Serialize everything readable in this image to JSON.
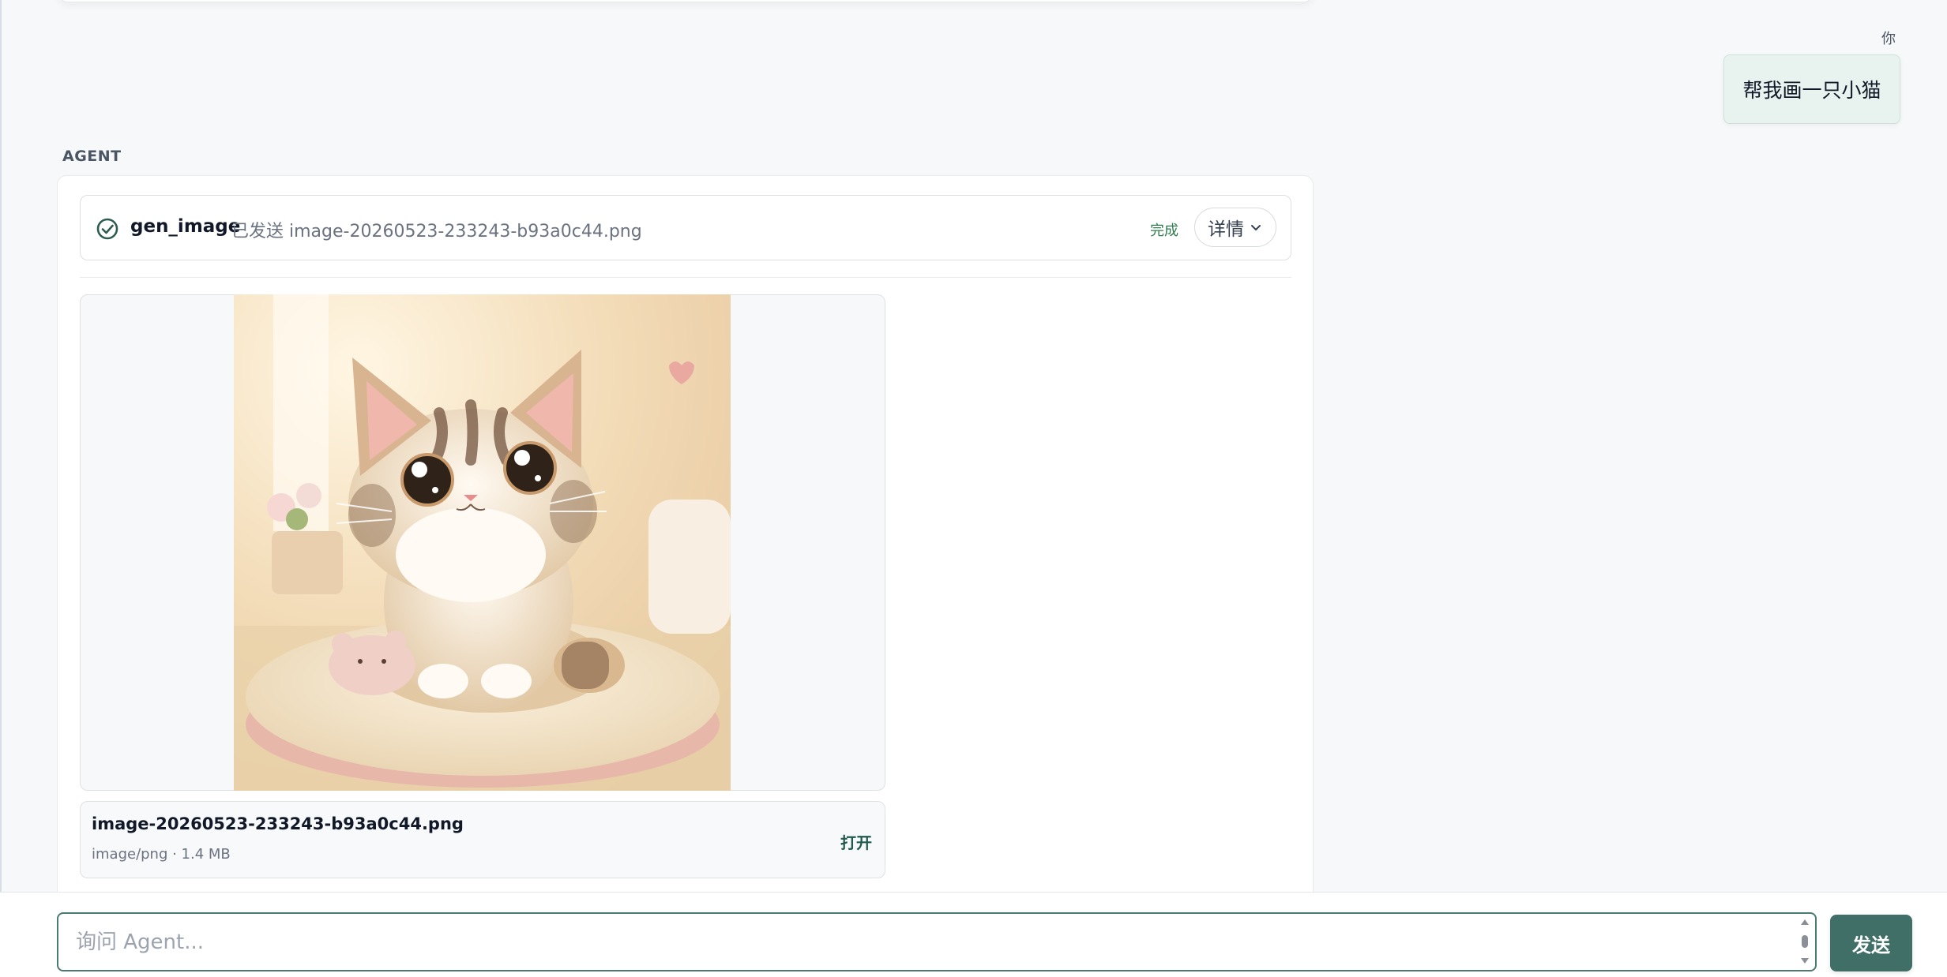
{
  "user": {
    "label": "你",
    "message": "帮我画一只小猫"
  },
  "agent": {
    "label": "AGENT",
    "tool_call": {
      "name": "gen_image",
      "description": "已发送 image-20260523-233243-b93a0c44.png",
      "status": "完成",
      "details_label": "详情"
    },
    "attachment": {
      "file_name": "image-20260523-233243-b93a0c44.png",
      "meta": "image/png · 1.4 MB",
      "open_label": "打开"
    }
  },
  "composer": {
    "placeholder": "询问 Agent...",
    "value": "",
    "send_label": "发送"
  },
  "colors": {
    "accent": "#3f6f66",
    "status_done": "#2f7d4f",
    "user_bubble": "#e8f2ef"
  },
  "icons": {
    "tool_status": "check-circle-icon",
    "details": "chevron-down-icon"
  }
}
